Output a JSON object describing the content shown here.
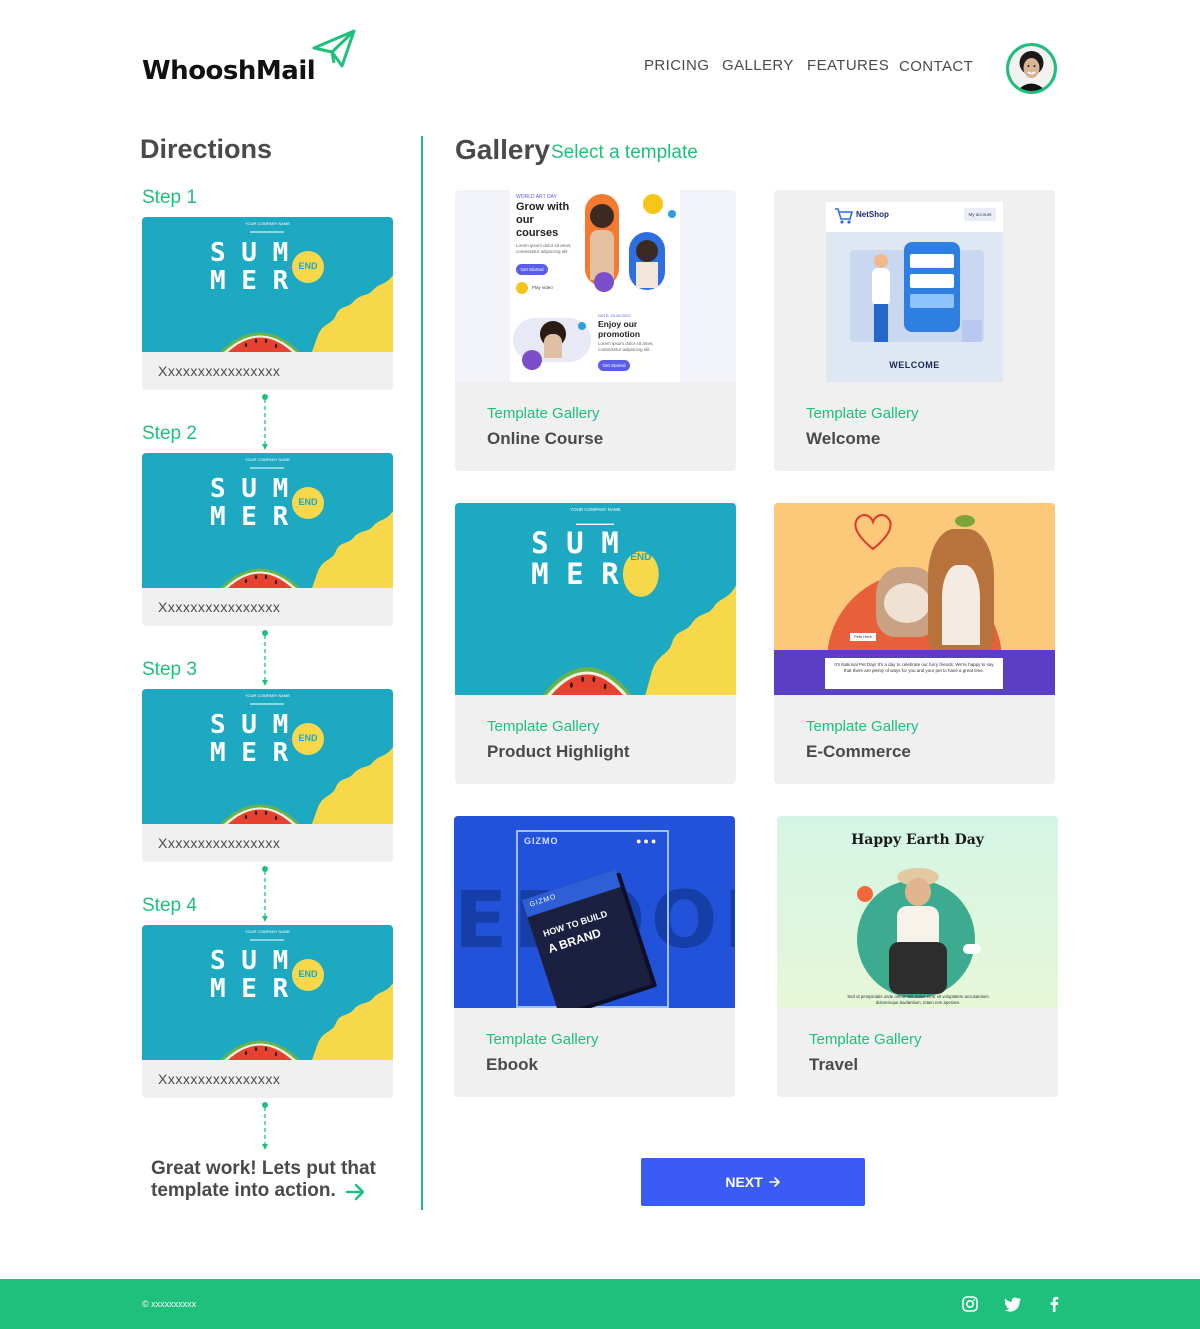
{
  "brand": {
    "name": "WhooshMail",
    "accent": "#1fbf7c",
    "button": "#3b5bf5"
  },
  "nav": {
    "items": [
      "PRICING",
      "GALLERY",
      "FEATURES",
      "CONTACT"
    ]
  },
  "directions": {
    "title": "Directions",
    "steps": [
      {
        "label": "Step 1",
        "caption": "Xxxxxxxxxxxxxxxx"
      },
      {
        "label": "Step 2",
        "caption": "Xxxxxxxxxxxxxxxx"
      },
      {
        "label": "Step 3",
        "caption": "Xxxxxxxxxxxxxxxx"
      },
      {
        "label": "Step 4",
        "caption": "Xxxxxxxxxxxxxxxx"
      }
    ],
    "finish_text": "Great work! Lets put that template into action."
  },
  "summer_thumb": {
    "company": "YOUR COMPANY NAME",
    "line1": "S U M",
    "line2": "M E R",
    "badge": "END"
  },
  "gallery": {
    "title": "Gallery",
    "subtitle": "Select a template",
    "cards": [
      {
        "category": "Template Gallery",
        "name": "Online Course",
        "img_text": {
          "kicker": "WORLD ART DAY",
          "headline": "Grow with our courses",
          "body": "Lorem ipsum dolor sit amet, consectetur adipiscing elit.",
          "cta": "Get Started",
          "play": "Play video",
          "date": "DATE: 20.08.2022",
          "headline2": "Enjoy our promotion",
          "body2": "Lorem ipsum dolor sit amet, consectetur adipiscing elit.",
          "cta2": "Get Started"
        }
      },
      {
        "category": "Template Gallery",
        "name": "Welcome",
        "img_text": {
          "shop": "NetShop",
          "account": "My account",
          "caption": "WELCOME"
        }
      },
      {
        "category": "Template Gallery",
        "name": "Product Highlight",
        "img_text": {}
      },
      {
        "category": "Template Gallery",
        "name": "E-Commerce",
        "img_text": {
          "tag": "Pets Here",
          "body": "It's National Pet Day! It's a day to celebrate our furry friends. We're happy to say that there are plenty of ways for you and your pet to have a great time."
        }
      },
      {
        "category": "Template Gallery",
        "name": "Ebook",
        "img_text": {
          "brand": "GIZMO",
          "book_brand": "GIZMO",
          "book_title_1": "HOW TO BUILD",
          "book_title_2": "A BRAND",
          "bg_word": "EBOOK"
        }
      },
      {
        "category": "Template Gallery",
        "name": "Travel",
        "img_text": {
          "headline": "Happy Earth Day",
          "body": "Sed ut perspiciatis unde omnis iste natus error sit voluptatem accusantium doloremque laudantium, totam rem aperiam."
        }
      }
    ],
    "next_label": "NEXT"
  },
  "footer": {
    "copyright": "© xxxxxxxxxx",
    "social": [
      "instagram-icon",
      "twitter-icon",
      "facebook-icon"
    ]
  }
}
